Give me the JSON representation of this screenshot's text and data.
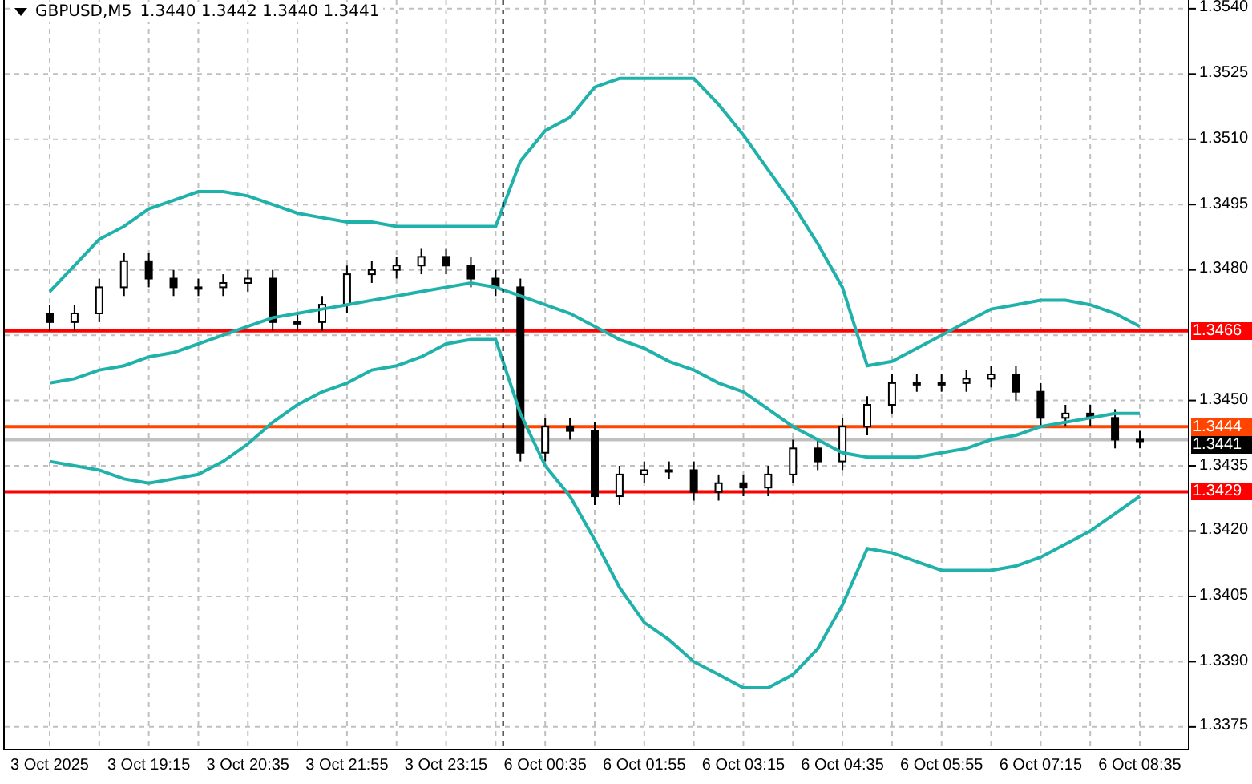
{
  "chart_header": {
    "symbol": "GBPUSD,M5",
    "ohlc": "1.3440 1.3442 1.3440 1.3441"
  },
  "chart": {
    "chart_data": {
      "type": "candlestick",
      "grid": true,
      "categories": [
        "3 Oct 2025",
        null,
        null,
        null,
        "3 Oct 19:15",
        null,
        null,
        null,
        "3 Oct 20:35",
        null,
        null,
        null,
        "3 Oct 21:55",
        null,
        null,
        null,
        "3 Oct 23:15",
        null,
        null,
        null,
        "6 Oct 00:35",
        null,
        null,
        null,
        "6 Oct 01:55",
        null,
        null,
        null,
        "6 Oct 03:15",
        null,
        null,
        null,
        "6 Oct 04:35",
        null,
        null,
        null,
        "6 Oct 05:55",
        null,
        null,
        null,
        "6 Oct 07:15",
        null,
        null,
        null,
        "6 Oct 08:35"
      ],
      "ylim": [
        1.337,
        1.3542
      ],
      "yticks": [
        {
          "value": 1.354,
          "label": "1.3540"
        },
        {
          "value": 1.3525,
          "label": "1.3525"
        },
        {
          "value": 1.351,
          "label": "1.3510"
        },
        {
          "value": 1.3495,
          "label": "1.3495"
        },
        {
          "value": 1.348,
          "label": "1.3480"
        },
        {
          "value": 1.345,
          "label": "1.3450"
        },
        {
          "value": 1.3435,
          "label": "1.3435"
        },
        {
          "value": 1.342,
          "label": "1.3420"
        },
        {
          "value": 1.3405,
          "label": "1.3405"
        },
        {
          "value": 1.339,
          "label": "1.3390"
        },
        {
          "value": 1.3375,
          "label": "1.3375"
        }
      ],
      "ohlc": [
        [
          1.347,
          1.3472,
          1.3466,
          1.3468
        ],
        [
          1.3468,
          1.3472,
          1.3466,
          1.347
        ],
        [
          1.347,
          1.3478,
          1.3468,
          1.3476
        ],
        [
          1.3476,
          1.3484,
          1.3474,
          1.3482
        ],
        [
          1.3482,
          1.3484,
          1.3476,
          1.3478
        ],
        [
          1.3478,
          1.348,
          1.3474,
          1.3476
        ],
        [
          1.3476,
          1.3478,
          1.3474,
          1.3476
        ],
        [
          1.3476,
          1.3479,
          1.3474,
          1.3477
        ],
        [
          1.3477,
          1.348,
          1.3475,
          1.3478
        ],
        [
          1.3478,
          1.348,
          1.3466,
          1.3468
        ],
        [
          1.3468,
          1.347,
          1.3466,
          1.3468
        ],
        [
          1.3468,
          1.3474,
          1.3466,
          1.3472
        ],
        [
          1.3472,
          1.3481,
          1.347,
          1.3479
        ],
        [
          1.3479,
          1.3482,
          1.3477,
          1.348
        ],
        [
          1.348,
          1.3483,
          1.3478,
          1.3481
        ],
        [
          1.3481,
          1.3485,
          1.3479,
          1.3483
        ],
        [
          1.3483,
          1.3485,
          1.3479,
          1.3481
        ],
        [
          1.3481,
          1.3483,
          1.3476,
          1.3478
        ],
        [
          1.3478,
          1.348,
          1.3474,
          1.3476
        ],
        [
          1.3476,
          1.3478,
          1.3436,
          1.3438
        ],
        [
          1.3438,
          1.3446,
          1.3436,
          1.3444
        ],
        [
          1.3444,
          1.3446,
          1.3441,
          1.3443
        ],
        [
          1.3443,
          1.3445,
          1.3426,
          1.3428
        ],
        [
          1.3428,
          1.3435,
          1.3426,
          1.3433
        ],
        [
          1.3433,
          1.3436,
          1.3431,
          1.3434
        ],
        [
          1.3434,
          1.3436,
          1.3432,
          1.3434
        ],
        [
          1.3434,
          1.3436,
          1.3427,
          1.3429
        ],
        [
          1.3429,
          1.3433,
          1.3427,
          1.3431
        ],
        [
          1.3431,
          1.3433,
          1.3428,
          1.343
        ],
        [
          1.343,
          1.3435,
          1.3428,
          1.3433
        ],
        [
          1.3433,
          1.3441,
          1.3431,
          1.3439
        ],
        [
          1.3439,
          1.3441,
          1.3434,
          1.3436
        ],
        [
          1.3436,
          1.3446,
          1.3434,
          1.3444
        ],
        [
          1.3444,
          1.3451,
          1.3442,
          1.3449
        ],
        [
          1.3449,
          1.3456,
          1.3447,
          1.3454
        ],
        [
          1.3454,
          1.3456,
          1.3452,
          1.3454
        ],
        [
          1.3454,
          1.3456,
          1.3452,
          1.3454
        ],
        [
          1.3454,
          1.3457,
          1.3452,
          1.3455
        ],
        [
          1.3455,
          1.3458,
          1.3453,
          1.3456
        ],
        [
          1.3456,
          1.3458,
          1.345,
          1.3452
        ],
        [
          1.3452,
          1.3454,
          1.3444,
          1.3446
        ],
        [
          1.3446,
          1.3449,
          1.3444,
          1.3447
        ],
        [
          1.3447,
          1.3449,
          1.3444,
          1.3446
        ],
        [
          1.3446,
          1.3448,
          1.3439,
          1.3441
        ],
        [
          1.3441,
          1.3443,
          1.3439,
          1.3441
        ]
      ],
      "series": [
        {
          "type": "line",
          "color": "#20b2aa",
          "values": [
            1.3475,
            1.3481,
            1.3487,
            1.349,
            1.3494,
            1.3496,
            1.3498,
            1.3498,
            1.3497,
            1.3495,
            1.3493,
            1.3492,
            1.3491,
            1.3491,
            1.349,
            1.349,
            1.349,
            1.349,
            1.349,
            1.3505,
            1.3512,
            1.3515,
            1.3522,
            1.3524,
            1.3524,
            1.3524,
            1.3524,
            1.3518,
            1.3511,
            1.3503,
            1.3495,
            1.3486,
            1.3476,
            1.3458,
            1.3459,
            1.3462,
            1.3465,
            1.3468,
            1.3471,
            1.3472,
            1.3473,
            1.3473,
            1.3472,
            1.347,
            1.3467
          ]
        },
        {
          "type": "line",
          "color": "#20b2aa",
          "values": [
            1.3454,
            1.3455,
            1.3457,
            1.3458,
            1.346,
            1.3461,
            1.3463,
            1.3465,
            1.3467,
            1.3469,
            1.347,
            1.3471,
            1.3472,
            1.3473,
            1.3474,
            1.3475,
            1.3476,
            1.3477,
            1.3476,
            1.3474,
            1.3472,
            1.347,
            1.3467,
            1.3464,
            1.3462,
            1.3459,
            1.3457,
            1.3454,
            1.3452,
            1.3448,
            1.3444,
            1.3441,
            1.3438,
            1.3437,
            1.3437,
            1.3437,
            1.3438,
            1.3439,
            1.3441,
            1.3442,
            1.3444,
            1.3445,
            1.3446,
            1.3447,
            1.3447
          ]
        },
        {
          "type": "line",
          "color": "#20b2aa",
          "values": [
            1.3436,
            1.3435,
            1.3434,
            1.3432,
            1.3431,
            1.3432,
            1.3433,
            1.3436,
            1.344,
            1.3445,
            1.3449,
            1.3452,
            1.3454,
            1.3457,
            1.3458,
            1.346,
            1.3463,
            1.3464,
            1.3464,
            1.3447,
            1.3435,
            1.3428,
            1.3418,
            1.3407,
            1.3399,
            1.3395,
            1.339,
            1.3387,
            1.3384,
            1.3384,
            1.3387,
            1.3393,
            1.3403,
            1.3416,
            1.3415,
            1.3413,
            1.3411,
            1.3411,
            1.3411,
            1.3412,
            1.3414,
            1.3417,
            1.342,
            1.3424,
            1.3428
          ]
        }
      ],
      "ref_lines": [
        {
          "axis": "y",
          "value": 1.3466,
          "label": "1.3466",
          "color": "#ff0000"
        },
        {
          "axis": "y",
          "value": 1.3444,
          "label": "1.3444",
          "color": "#ff4500"
        },
        {
          "axis": "y",
          "value": 1.3441,
          "label": "1.3441",
          "color": "#c0c0c0"
        },
        {
          "axis": "y",
          "value": 1.3429,
          "label": "1.3429",
          "color": "#ff0000"
        }
      ]
    }
  }
}
